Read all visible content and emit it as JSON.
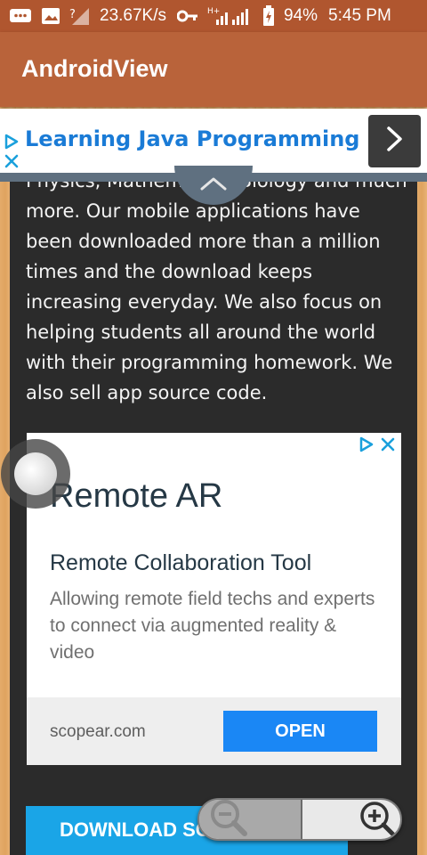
{
  "status_bar": {
    "network_speed": "23.67K/s",
    "network_type": "H+",
    "battery": "94%",
    "time": "5:45 PM"
  },
  "app_bar": {
    "title": "AndroidView"
  },
  "top_ad": {
    "title": "Learning Java Programming",
    "accent": "#1a7bd6"
  },
  "main": {
    "body_text": "Physics, Mathematics, Biology and much more. Our mobile applications have been downloaded more than a million times and the download keeps increasing everyday. We also focus on helping students all around the world with their programming homework. We also sell app source code."
  },
  "native_ad": {
    "headline": "Remote AR",
    "subtitle": "Remote Collaboration Tool",
    "description": "Allowing remote field techs and experts to connect via augmented reality & video",
    "domain": "scopear.com",
    "cta": "OPEN",
    "cta_color": "#1a87f5"
  },
  "download_button": {
    "label": "DOWNLOAD SOURCE CODE"
  },
  "colors": {
    "status_bar": "#b0562f",
    "app_bar": "#b9633a",
    "content_panel": "#2b2b2b",
    "download_button": "#1aa5e7"
  },
  "icons": [
    "message-icon",
    "image-icon",
    "signal-unknown-icon",
    "key-icon",
    "signal-icon",
    "battery-icon",
    "ad-play-icon",
    "ad-close-icon",
    "chevron-right-icon",
    "chevron-up-icon",
    "zoom-out-icon",
    "zoom-in-icon"
  ]
}
